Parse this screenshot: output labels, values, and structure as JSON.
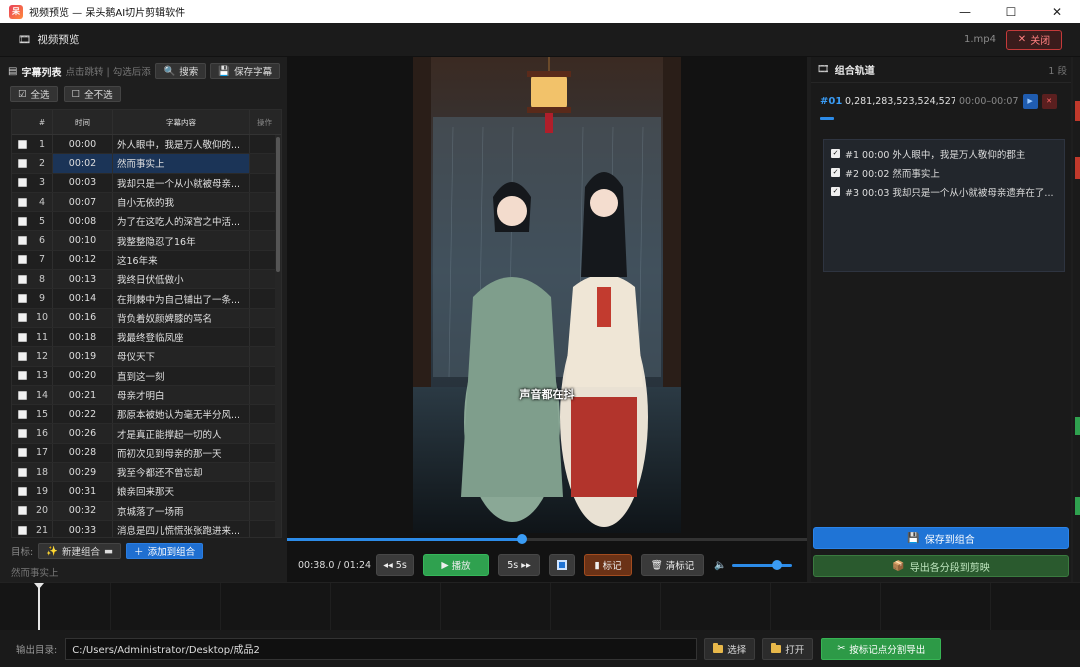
{
  "window": {
    "title": "视频预览 — 呆头鹅AI切片剪辑软件",
    "app_icon": "呆",
    "min": "—",
    "max": "☐",
    "close": "✕"
  },
  "header": {
    "title": "视频预览",
    "filename": "1.mp4",
    "close_label": "关闭"
  },
  "subtitles": {
    "title": "字幕列表",
    "hint": "点击跳转 | 勾选后添",
    "search_label": "搜索",
    "save_label": "保存字幕",
    "select_all": "全选",
    "select_none": "全不选",
    "columns": [
      "#",
      "时间",
      "字幕内容",
      "操作"
    ],
    "rows": [
      {
        "idx": "1",
        "time": "00:00",
        "text": "外人眼中，我是万人敬仰的..."
      },
      {
        "idx": "2",
        "time": "00:02",
        "text": "然而事实上",
        "selected": true
      },
      {
        "idx": "3",
        "time": "00:03",
        "text": "我却只是一个从小就被母亲..."
      },
      {
        "idx": "4",
        "time": "00:07",
        "text": "自小无依的我"
      },
      {
        "idx": "5",
        "time": "00:08",
        "text": "为了在这吃人的深宫之中活..."
      },
      {
        "idx": "6",
        "time": "00:10",
        "text": "我整整隐忍了16年"
      },
      {
        "idx": "7",
        "time": "00:12",
        "text": "这16年来"
      },
      {
        "idx": "8",
        "time": "00:13",
        "text": "我终日伏低做小"
      },
      {
        "idx": "9",
        "time": "00:14",
        "text": "在荆棘中为自己铺出了一条..."
      },
      {
        "idx": "10",
        "time": "00:16",
        "text": "背负着奴颜婢膝的骂名"
      },
      {
        "idx": "11",
        "time": "00:18",
        "text": "我最终登临凤座"
      },
      {
        "idx": "12",
        "time": "00:19",
        "text": "母仪天下"
      },
      {
        "idx": "13",
        "time": "00:20",
        "text": "直到这一刻"
      },
      {
        "idx": "14",
        "time": "00:21",
        "text": "母亲才明白"
      },
      {
        "idx": "15",
        "time": "00:22",
        "text": "那原本被她认为毫无半分风..."
      },
      {
        "idx": "16",
        "time": "00:26",
        "text": "才是真正能撑起一切的人"
      },
      {
        "idx": "17",
        "time": "00:28",
        "text": "而初次见到母亲的那一天"
      },
      {
        "idx": "18",
        "time": "00:29",
        "text": "我至今都还不曾忘却"
      },
      {
        "idx": "19",
        "time": "00:31",
        "text": "娘亲回来那天"
      },
      {
        "idx": "20",
        "time": "00:32",
        "text": "京城落了一场雨"
      },
      {
        "idx": "21",
        "time": "00:33",
        "text": "消息是四儿慌慌张张跑进来..."
      }
    ],
    "target_label": "目标:",
    "new_combo_label": "新建组合",
    "add_to_combo_label": "添加到组合",
    "current_subtitle": "然而事实上"
  },
  "player": {
    "caption": "声音都在抖",
    "timecode": "00:38.0 / 01:24",
    "progress": 0.452,
    "back_label": "◂◂ 5s",
    "play_label": "播放",
    "fwd_label": "5s ▸▸",
    "mark_label": "标记",
    "clear_label": "清标记",
    "volume": 0.75
  },
  "combos": {
    "title": "组合轨道",
    "count": "1 段",
    "combo_id": "#01",
    "combo_ids": "0,281,283,523,524,527",
    "combo_range": "00:00–00:07",
    "items": [
      {
        "label": "#1  00:00  外人眼中，我是万人敬仰的郡主"
      },
      {
        "label": "#2  00:02  然而事实上"
      },
      {
        "label": "#3  00:03  我却只是一个从小就被母亲遗弃在了..."
      }
    ],
    "save_label": "保存到组合",
    "export_label": "导出各分段到剪映"
  },
  "output": {
    "label": "输出目录:",
    "path": "C:/Users/Administrator/Desktop/成品2",
    "choose_label": "选择",
    "open_label": "打开",
    "export_label": "按标记点分割导出"
  },
  "colors": {
    "accent_blue": "#2c8be8",
    "play_green": "#2fa14f",
    "mark_orange": "#a34c1f",
    "close_red": "#c43a3a"
  }
}
